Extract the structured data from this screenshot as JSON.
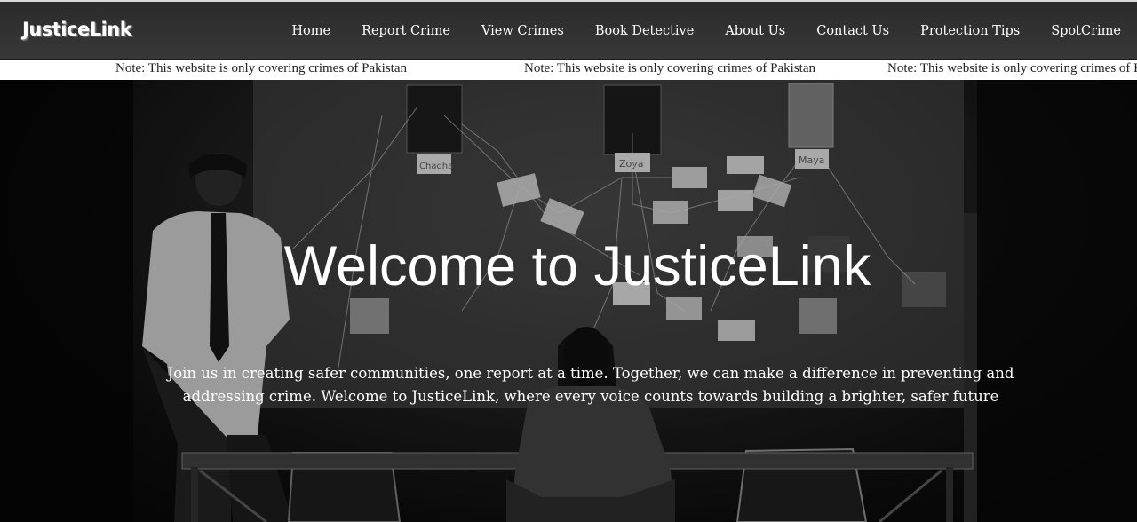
{
  "brand": {
    "logo": "JusticeLink"
  },
  "nav": {
    "items": [
      {
        "label": "Home"
      },
      {
        "label": "Report Crime"
      },
      {
        "label": "View Crimes"
      },
      {
        "label": "Book Detective"
      },
      {
        "label": "About Us"
      },
      {
        "label": "Contact Us"
      },
      {
        "label": "Protection Tips"
      },
      {
        "label": "SpotCrime"
      }
    ]
  },
  "marquee": {
    "items": [
      "Note: This website is only covering crimes of Pakistan",
      "Note: This website is only covering crimes of Pakistan",
      "Note: This website is only covering crimes of Pakistan"
    ]
  },
  "hero": {
    "title": "Welcome to JusticeLink",
    "text": "Join us in creating safer communities, one report at a time. Together, we can make a difference in preventing and addressing crime. Welcome to JusticeLink, where every voice counts towards building a brighter, safer future",
    "image": "interrogation-room-photo"
  },
  "board": {
    "labels": [
      "Chaqha",
      "Zoya",
      "Maya"
    ]
  },
  "colors": {
    "navbar": "#333333",
    "marquee_bg": "#ffffff",
    "text_light": "#ffffff",
    "text_dark": "#222222"
  }
}
